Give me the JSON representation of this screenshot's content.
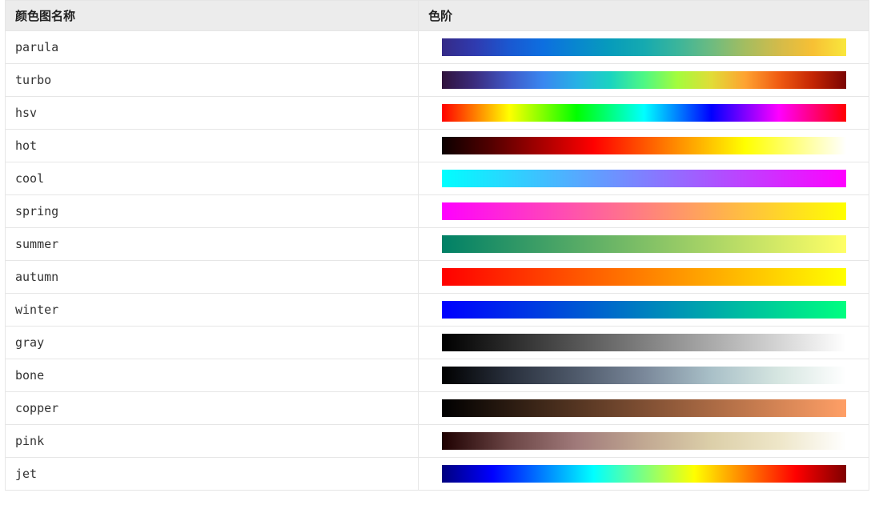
{
  "headers": {
    "name": "颜色图名称",
    "scale": "色阶"
  },
  "rows": [
    {
      "name": "parula",
      "class": "g-parula"
    },
    {
      "name": "turbo",
      "class": "g-turbo"
    },
    {
      "name": "hsv",
      "class": "g-hsv"
    },
    {
      "name": "hot",
      "class": "g-hot"
    },
    {
      "name": "cool",
      "class": "g-cool"
    },
    {
      "name": "spring",
      "class": "g-spring"
    },
    {
      "name": "summer",
      "class": "g-summer"
    },
    {
      "name": "autumn",
      "class": "g-autumn"
    },
    {
      "name": "winter",
      "class": "g-winter"
    },
    {
      "name": "gray",
      "class": "g-gray"
    },
    {
      "name": "bone",
      "class": "g-bone"
    },
    {
      "name": "copper",
      "class": "g-copper"
    },
    {
      "name": "pink",
      "class": "g-pink"
    },
    {
      "name": "jet",
      "class": "g-jet"
    }
  ],
  "gradients": {
    "parula": [
      "#352a87",
      "#2f3bb0",
      "#1a58d1",
      "#0d6fe0",
      "#0887cf",
      "#079cbb",
      "#15aab0",
      "#3bb59b",
      "#6dbb80",
      "#a4bd60",
      "#d3bb4a",
      "#f7c034",
      "#f9e73c"
    ],
    "turbo": [
      "#30123b",
      "#3b2d80",
      "#3f59c8",
      "#3a87f0",
      "#27b1e5",
      "#1ad4c0",
      "#4df884",
      "#a4fc3c",
      "#e1dc37",
      "#fea331",
      "#f05b12",
      "#c42503",
      "#7a0403"
    ],
    "hsv": [
      "#ff0000",
      "#ffff00",
      "#00ff00",
      "#00ffff",
      "#0000ff",
      "#ff00ff",
      "#ff0000"
    ],
    "hot": [
      "#0b0000",
      "#550000",
      "#aa0000",
      "#ff0000",
      "#ff5500",
      "#ffaa00",
      "#ffff00",
      "#ffff80",
      "#ffffff"
    ],
    "cool": [
      "#00ffff",
      "#ff00ff"
    ],
    "spring": [
      "#ff00ff",
      "#ffff00"
    ],
    "summer": [
      "#008066",
      "#ffff66"
    ],
    "autumn": [
      "#ff0000",
      "#ffff00"
    ],
    "winter": [
      "#0000ff",
      "#00ff80"
    ],
    "gray": [
      "#000000",
      "#ffffff"
    ],
    "bone": [
      "#000000",
      "#29303d",
      "#4f5a6b",
      "#7a889a",
      "#a9c0c8",
      "#d6e6e1",
      "#ffffff"
    ],
    "copper": [
      "#000000",
      "#3f2819",
      "#7f4f33",
      "#bf774c",
      "#ff9f66"
    ],
    "pink": [
      "#1e0000",
      "#6b4545",
      "#a07a7a",
      "#c1a892",
      "#dccfa9",
      "#eee6c8",
      "#ffffff"
    ],
    "jet": [
      "#00007f",
      "#0000ff",
      "#007fff",
      "#00ffff",
      "#7fff7f",
      "#ffff00",
      "#ff7f00",
      "#ff0000",
      "#7f0000"
    ]
  }
}
